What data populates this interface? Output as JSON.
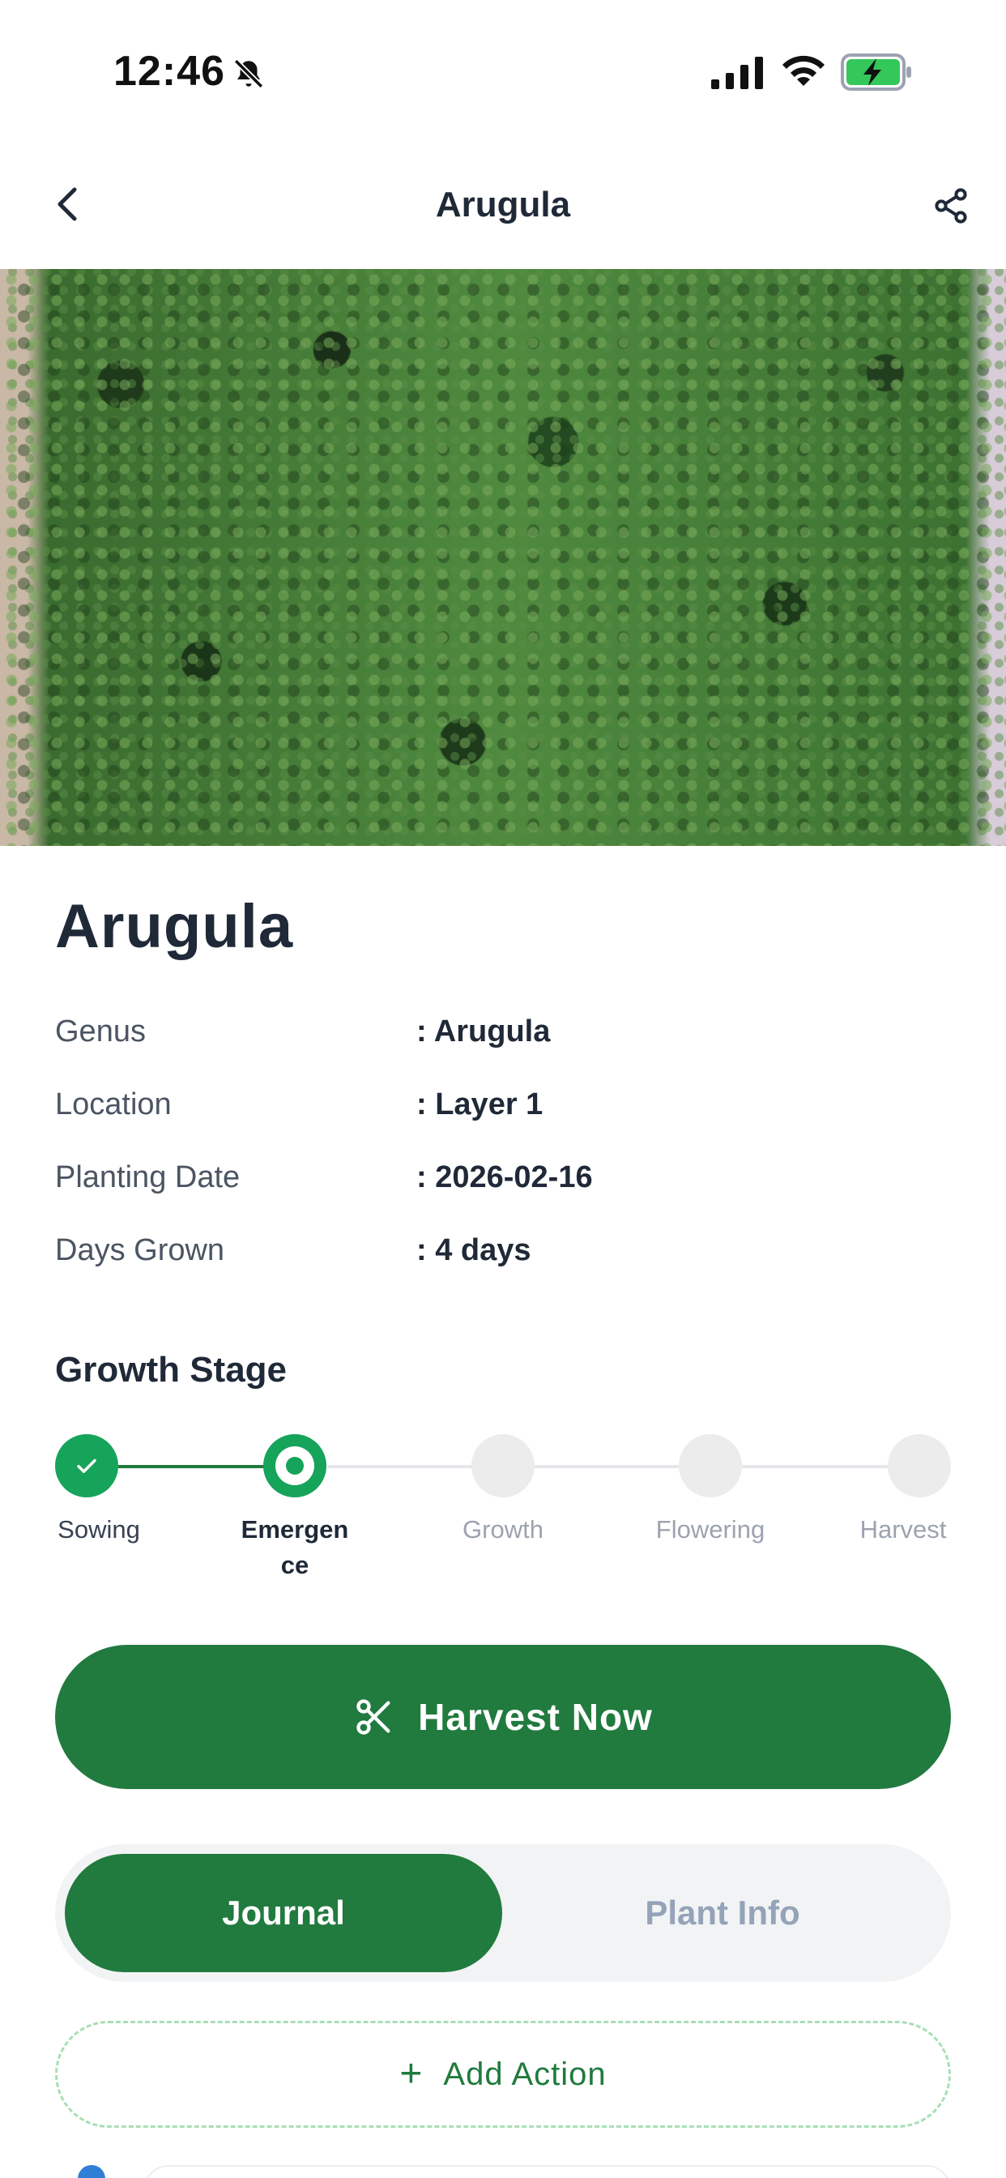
{
  "status_bar": {
    "time": "12:46",
    "icons": [
      "bell-slash-icon",
      "signal-icon",
      "wifi-icon",
      "battery-charging-icon"
    ]
  },
  "nav": {
    "title": "Arugula",
    "back_icon": "chevron-left-icon",
    "share_icon": "share-icon"
  },
  "plant": {
    "name": "Arugula",
    "details": [
      {
        "label": "Genus",
        "value": ": Arugula"
      },
      {
        "label": "Location",
        "value": ": Layer 1"
      },
      {
        "label": "Planting Date",
        "value": ": 2026-02-16"
      },
      {
        "label": "Days Grown",
        "value": ": 4 days"
      }
    ]
  },
  "growth_stage": {
    "title": "Growth Stage",
    "stages": [
      {
        "label": "Sowing",
        "state": "completed"
      },
      {
        "label": "Emergence",
        "state": "current"
      },
      {
        "label": "Growth",
        "state": "upcoming"
      },
      {
        "label": "Flowering",
        "state": "upcoming"
      },
      {
        "label": "Harvest",
        "state": "upcoming"
      }
    ]
  },
  "harvest_button": {
    "label": "Harvest Now",
    "icon": "scissors-icon"
  },
  "tabs": [
    {
      "label": "Journal",
      "active": true
    },
    {
      "label": "Plant Info",
      "active": false
    }
  ],
  "add_action": {
    "label": "Add Action",
    "icon": "plus-icon"
  },
  "colors": {
    "primary": "#217a3e",
    "accent": "#16a35a",
    "muted": "#9ca3af",
    "tab_bg": "#f2f3f5",
    "dashed_border": "#a7dfb6"
  }
}
